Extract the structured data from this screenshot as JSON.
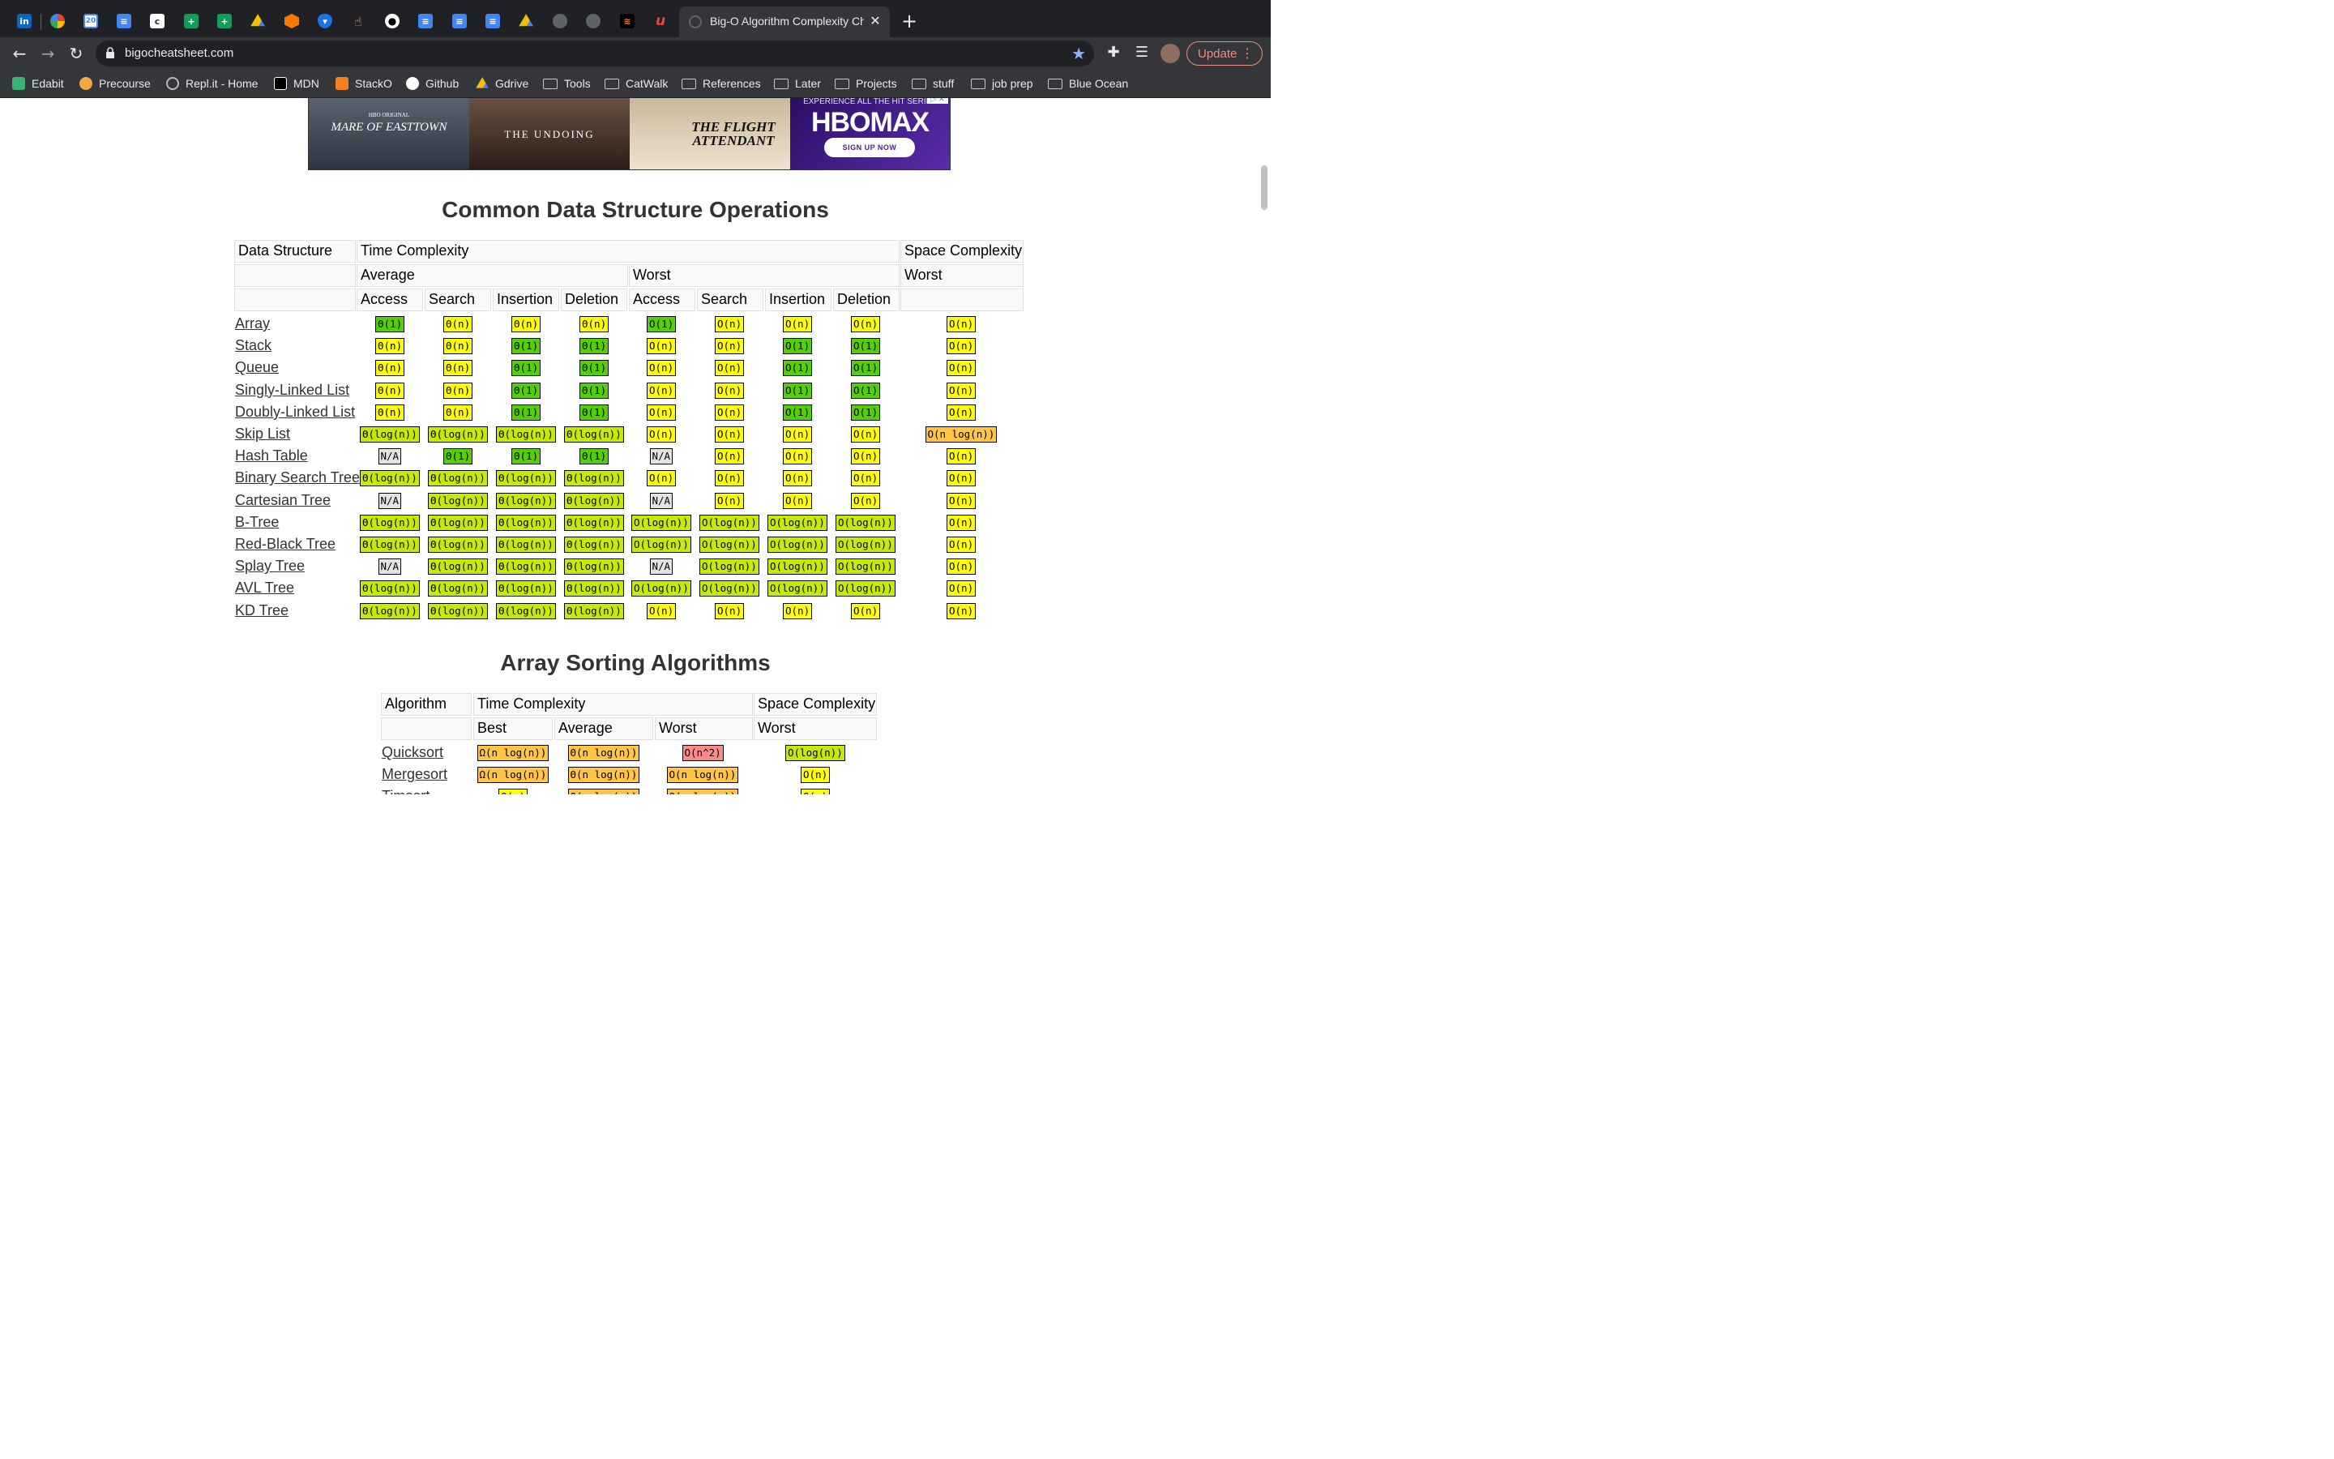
{
  "browser": {
    "active_tab_title": "Big-O Algorithm Complexity Cheat Sheet",
    "url": "bigocheatsheet.com",
    "update_label": "Update",
    "bookmarks": [
      "Edabit",
      "Precourse",
      "Repl.it - Home",
      "MDN",
      "StackO",
      "Github",
      "Gdrive",
      "Tools",
      "CatWalk",
      "References",
      "Later",
      "Projects",
      "stuff",
      "job prep",
      "Blue Ocean"
    ]
  },
  "ad": {
    "show1": "MARE OF EASTTOWN",
    "show2": "THE UNDOING",
    "show3": "THE FLIGHT ATTENDANT",
    "brand": "HBOMAX",
    "tagline": "EXPERIENCE ALL THE HIT SERIES",
    "cta": "SIGN UP NOW",
    "hbo_original": "HBO ORIGINAL"
  },
  "colors": {
    "green": "#53d000",
    "yellowgreen": "#c8ea00",
    "yellow": "#ffff00",
    "orange": "#ffc543",
    "red": "#ff8989",
    "gray": "#e3e3e3"
  },
  "ds_table": {
    "title": "Common Data Structure Operations",
    "h_data_structure": "Data Structure",
    "h_time": "Time Complexity",
    "h_space": "Space Complexity",
    "h_average": "Average",
    "h_worst": "Worst",
    "h_worst_space": "Worst",
    "ops": [
      "Access",
      "Search",
      "Insertion",
      "Deletion",
      "Access",
      "Search",
      "Insertion",
      "Deletion"
    ],
    "rows": [
      {
        "name": "Array",
        "cells": [
          [
            "Θ(1)",
            "green"
          ],
          [
            "Θ(n)",
            "yellow"
          ],
          [
            "Θ(n)",
            "yellow"
          ],
          [
            "Θ(n)",
            "yellow"
          ],
          [
            "O(1)",
            "green"
          ],
          [
            "O(n)",
            "yellow"
          ],
          [
            "O(n)",
            "yellow"
          ],
          [
            "O(n)",
            "yellow"
          ],
          [
            "O(n)",
            "yellow"
          ]
        ]
      },
      {
        "name": "Stack",
        "cells": [
          [
            "Θ(n)",
            "yellow"
          ],
          [
            "Θ(n)",
            "yellow"
          ],
          [
            "Θ(1)",
            "green"
          ],
          [
            "Θ(1)",
            "green"
          ],
          [
            "O(n)",
            "yellow"
          ],
          [
            "O(n)",
            "yellow"
          ],
          [
            "O(1)",
            "green"
          ],
          [
            "O(1)",
            "green"
          ],
          [
            "O(n)",
            "yellow"
          ]
        ]
      },
      {
        "name": "Queue",
        "cells": [
          [
            "Θ(n)",
            "yellow"
          ],
          [
            "Θ(n)",
            "yellow"
          ],
          [
            "Θ(1)",
            "green"
          ],
          [
            "Θ(1)",
            "green"
          ],
          [
            "O(n)",
            "yellow"
          ],
          [
            "O(n)",
            "yellow"
          ],
          [
            "O(1)",
            "green"
          ],
          [
            "O(1)",
            "green"
          ],
          [
            "O(n)",
            "yellow"
          ]
        ]
      },
      {
        "name": "Singly-Linked List",
        "cells": [
          [
            "Θ(n)",
            "yellow"
          ],
          [
            "Θ(n)",
            "yellow"
          ],
          [
            "Θ(1)",
            "green"
          ],
          [
            "Θ(1)",
            "green"
          ],
          [
            "O(n)",
            "yellow"
          ],
          [
            "O(n)",
            "yellow"
          ],
          [
            "O(1)",
            "green"
          ],
          [
            "O(1)",
            "green"
          ],
          [
            "O(n)",
            "yellow"
          ]
        ]
      },
      {
        "name": "Doubly-Linked List",
        "cells": [
          [
            "Θ(n)",
            "yellow"
          ],
          [
            "Θ(n)",
            "yellow"
          ],
          [
            "Θ(1)",
            "green"
          ],
          [
            "Θ(1)",
            "green"
          ],
          [
            "O(n)",
            "yellow"
          ],
          [
            "O(n)",
            "yellow"
          ],
          [
            "O(1)",
            "green"
          ],
          [
            "O(1)",
            "green"
          ],
          [
            "O(n)",
            "yellow"
          ]
        ]
      },
      {
        "name": "Skip List",
        "cells": [
          [
            "Θ(log(n))",
            "yellowgreen"
          ],
          [
            "Θ(log(n))",
            "yellowgreen"
          ],
          [
            "Θ(log(n))",
            "yellowgreen"
          ],
          [
            "Θ(log(n))",
            "yellowgreen"
          ],
          [
            "O(n)",
            "yellow"
          ],
          [
            "O(n)",
            "yellow"
          ],
          [
            "O(n)",
            "yellow"
          ],
          [
            "O(n)",
            "yellow"
          ],
          [
            "O(n log(n))",
            "orange"
          ]
        ]
      },
      {
        "name": "Hash Table",
        "cells": [
          [
            "N/A",
            "gray"
          ],
          [
            "Θ(1)",
            "green"
          ],
          [
            "Θ(1)",
            "green"
          ],
          [
            "Θ(1)",
            "green"
          ],
          [
            "N/A",
            "gray"
          ],
          [
            "O(n)",
            "yellow"
          ],
          [
            "O(n)",
            "yellow"
          ],
          [
            "O(n)",
            "yellow"
          ],
          [
            "O(n)",
            "yellow"
          ]
        ]
      },
      {
        "name": "Binary Search Tree",
        "cells": [
          [
            "Θ(log(n))",
            "yellowgreen"
          ],
          [
            "Θ(log(n))",
            "yellowgreen"
          ],
          [
            "Θ(log(n))",
            "yellowgreen"
          ],
          [
            "Θ(log(n))",
            "yellowgreen"
          ],
          [
            "O(n)",
            "yellow"
          ],
          [
            "O(n)",
            "yellow"
          ],
          [
            "O(n)",
            "yellow"
          ],
          [
            "O(n)",
            "yellow"
          ],
          [
            "O(n)",
            "yellow"
          ]
        ]
      },
      {
        "name": "Cartesian Tree",
        "cells": [
          [
            "N/A",
            "gray"
          ],
          [
            "Θ(log(n))",
            "yellowgreen"
          ],
          [
            "Θ(log(n))",
            "yellowgreen"
          ],
          [
            "Θ(log(n))",
            "yellowgreen"
          ],
          [
            "N/A",
            "gray"
          ],
          [
            "O(n)",
            "yellow"
          ],
          [
            "O(n)",
            "yellow"
          ],
          [
            "O(n)",
            "yellow"
          ],
          [
            "O(n)",
            "yellow"
          ]
        ]
      },
      {
        "name": "B-Tree",
        "cells": [
          [
            "Θ(log(n))",
            "yellowgreen"
          ],
          [
            "Θ(log(n))",
            "yellowgreen"
          ],
          [
            "Θ(log(n))",
            "yellowgreen"
          ],
          [
            "Θ(log(n))",
            "yellowgreen"
          ],
          [
            "O(log(n))",
            "yellowgreen"
          ],
          [
            "O(log(n))",
            "yellowgreen"
          ],
          [
            "O(log(n))",
            "yellowgreen"
          ],
          [
            "O(log(n))",
            "yellowgreen"
          ],
          [
            "O(n)",
            "yellow"
          ]
        ]
      },
      {
        "name": "Red-Black Tree",
        "cells": [
          [
            "Θ(log(n))",
            "yellowgreen"
          ],
          [
            "Θ(log(n))",
            "yellowgreen"
          ],
          [
            "Θ(log(n))",
            "yellowgreen"
          ],
          [
            "Θ(log(n))",
            "yellowgreen"
          ],
          [
            "O(log(n))",
            "yellowgreen"
          ],
          [
            "O(log(n))",
            "yellowgreen"
          ],
          [
            "O(log(n))",
            "yellowgreen"
          ],
          [
            "O(log(n))",
            "yellowgreen"
          ],
          [
            "O(n)",
            "yellow"
          ]
        ]
      },
      {
        "name": "Splay Tree",
        "cells": [
          [
            "N/A",
            "gray"
          ],
          [
            "Θ(log(n))",
            "yellowgreen"
          ],
          [
            "Θ(log(n))",
            "yellowgreen"
          ],
          [
            "Θ(log(n))",
            "yellowgreen"
          ],
          [
            "N/A",
            "gray"
          ],
          [
            "O(log(n))",
            "yellowgreen"
          ],
          [
            "O(log(n))",
            "yellowgreen"
          ],
          [
            "O(log(n))",
            "yellowgreen"
          ],
          [
            "O(n)",
            "yellow"
          ]
        ]
      },
      {
        "name": "AVL Tree",
        "cells": [
          [
            "Θ(log(n))",
            "yellowgreen"
          ],
          [
            "Θ(log(n))",
            "yellowgreen"
          ],
          [
            "Θ(log(n))",
            "yellowgreen"
          ],
          [
            "Θ(log(n))",
            "yellowgreen"
          ],
          [
            "O(log(n))",
            "yellowgreen"
          ],
          [
            "O(log(n))",
            "yellowgreen"
          ],
          [
            "O(log(n))",
            "yellowgreen"
          ],
          [
            "O(log(n))",
            "yellowgreen"
          ],
          [
            "O(n)",
            "yellow"
          ]
        ]
      },
      {
        "name": "KD Tree",
        "cells": [
          [
            "Θ(log(n))",
            "yellowgreen"
          ],
          [
            "Θ(log(n))",
            "yellowgreen"
          ],
          [
            "Θ(log(n))",
            "yellowgreen"
          ],
          [
            "Θ(log(n))",
            "yellowgreen"
          ],
          [
            "O(n)",
            "yellow"
          ],
          [
            "O(n)",
            "yellow"
          ],
          [
            "O(n)",
            "yellow"
          ],
          [
            "O(n)",
            "yellow"
          ],
          [
            "O(n)",
            "yellow"
          ]
        ]
      }
    ]
  },
  "sort_table": {
    "title": "Array Sorting Algorithms",
    "h_algorithm": "Algorithm",
    "h_time": "Time Complexity",
    "h_space": "Space Complexity",
    "h_best": "Best",
    "h_average": "Average",
    "h_worst": "Worst",
    "h_worst_space": "Worst",
    "rows": [
      {
        "name": "Quicksort",
        "cells": [
          [
            "Ω(n log(n))",
            "orange"
          ],
          [
            "Θ(n log(n))",
            "orange"
          ],
          [
            "O(n^2)",
            "red"
          ],
          [
            "O(log(n))",
            "yellowgreen"
          ]
        ]
      },
      {
        "name": "Mergesort",
        "cells": [
          [
            "Ω(n log(n))",
            "orange"
          ],
          [
            "Θ(n log(n))",
            "orange"
          ],
          [
            "O(n log(n))",
            "orange"
          ],
          [
            "O(n)",
            "yellow"
          ]
        ]
      },
      {
        "name": "Timsort",
        "cells": [
          [
            "Ω(n)",
            "yellow"
          ],
          [
            "Θ(n log(n))",
            "orange"
          ],
          [
            "O(n log(n))",
            "orange"
          ],
          [
            "O(n)",
            "yellow"
          ]
        ]
      }
    ]
  }
}
